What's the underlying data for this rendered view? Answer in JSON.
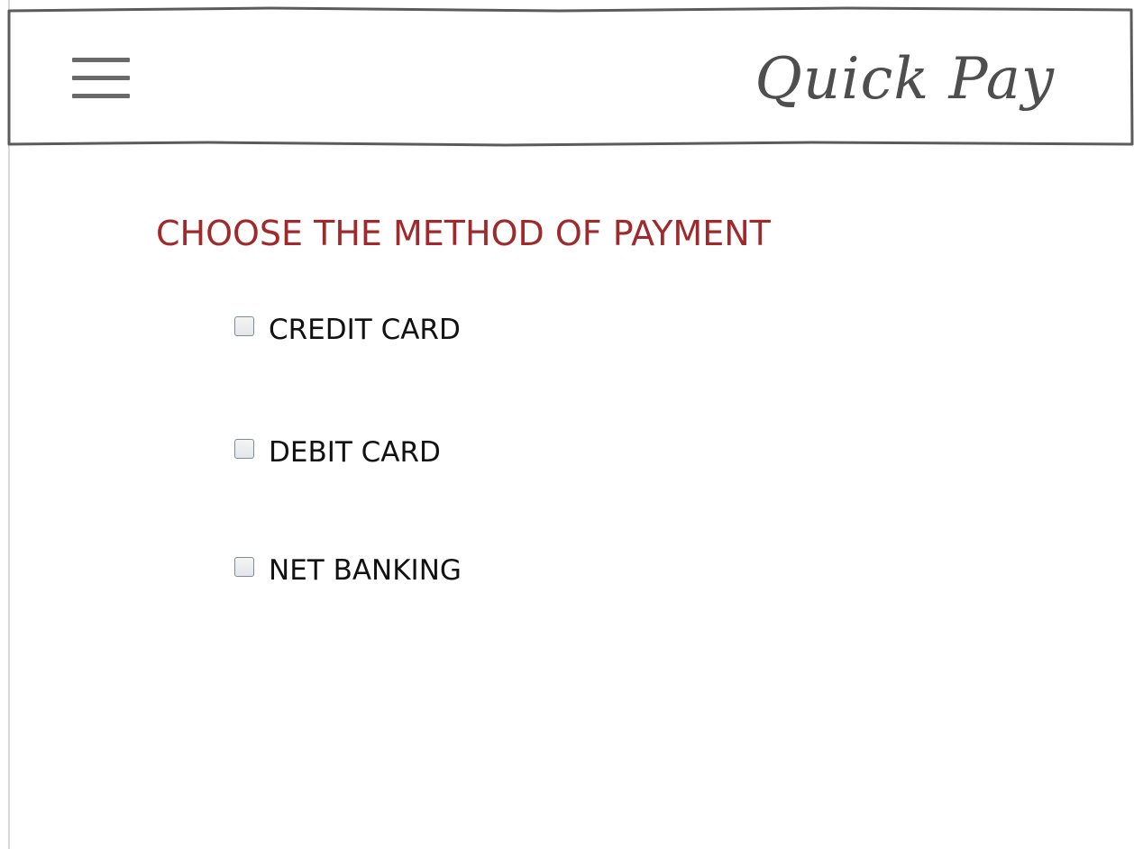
{
  "header": {
    "menu_icon": "hamburger-menu-icon",
    "brand": "Quick Pay",
    "text_color": "#4e4e4e",
    "border_color": "#5b5b5b"
  },
  "main": {
    "title": "CHOOSE THE METHOD OF PAYMENT",
    "title_color": "#a0292b",
    "options": [
      {
        "label": "CREDIT CARD",
        "checked": false
      },
      {
        "label": "DEBIT CARD",
        "checked": false
      },
      {
        "label": "NET BANKING",
        "checked": false
      }
    ]
  }
}
